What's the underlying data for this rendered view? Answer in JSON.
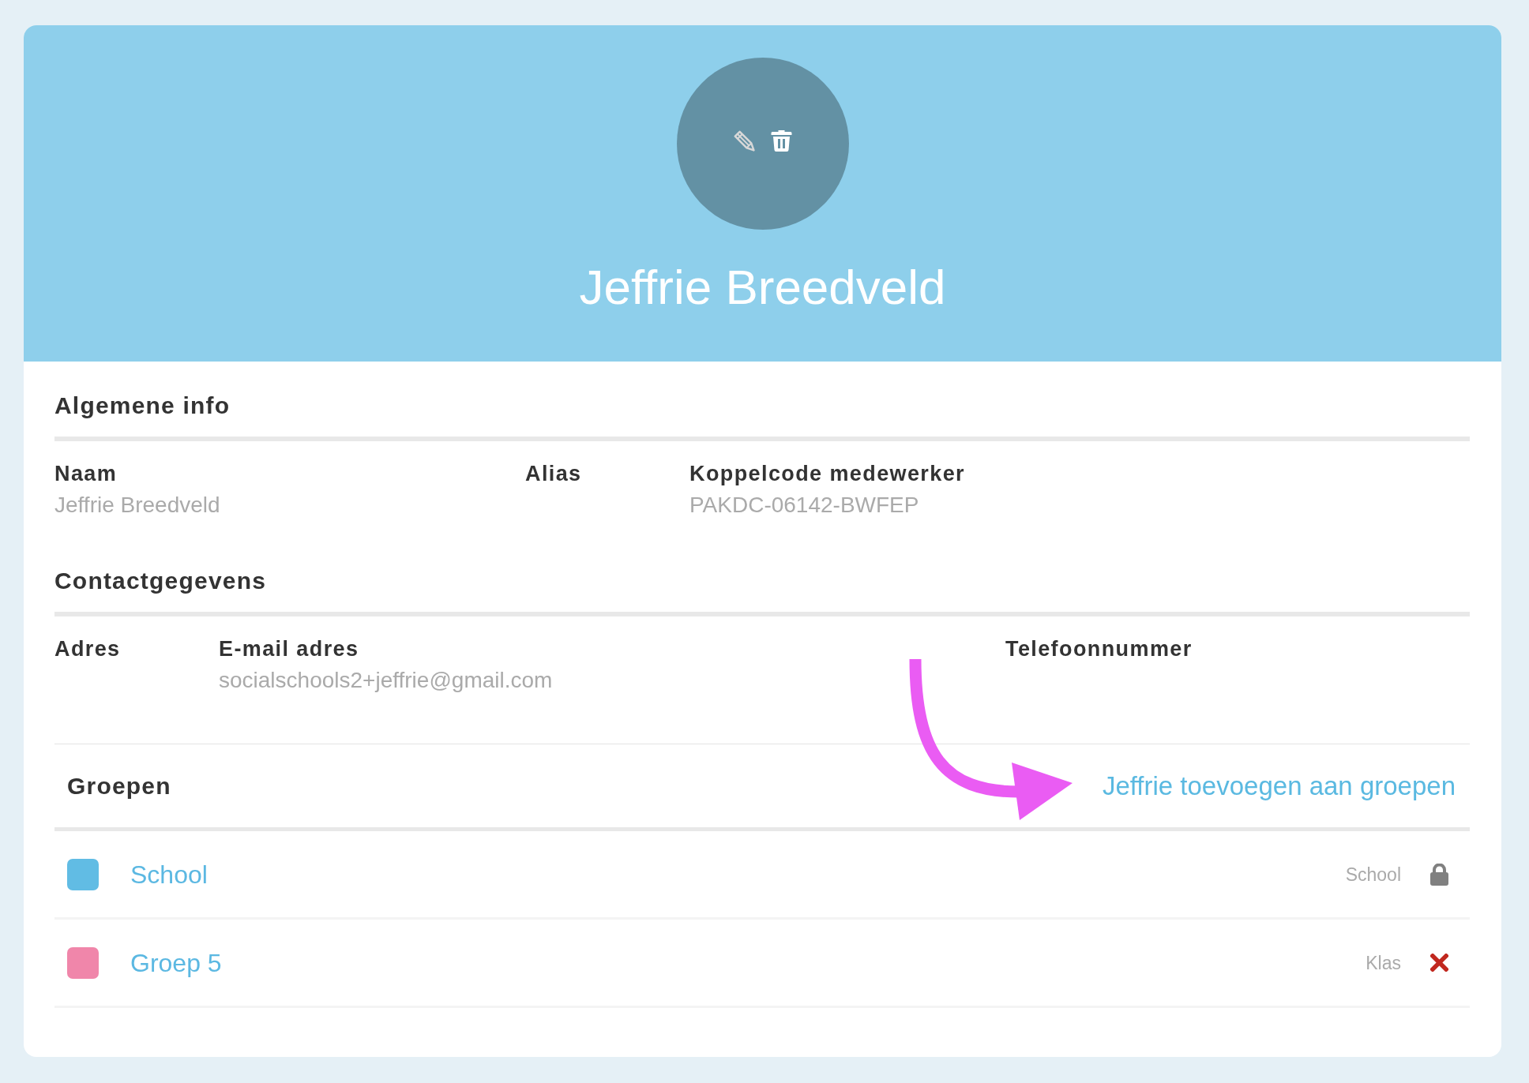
{
  "profile": {
    "name": "Jeffrie Breedveld"
  },
  "sections": [
    {
      "title": "Algemene info",
      "fields": [
        {
          "label": "Naam",
          "value": "Jeffrie Breedveld"
        },
        {
          "label": "Alias"
        },
        {
          "label": "Koppelcode medewerker",
          "value": "PAKDC-06142-BWFEP"
        }
      ]
    },
    {
      "title": "Contactgegevens",
      "fields": [
        {
          "label": "Adres"
        },
        {
          "label": "E-mail adres",
          "value": "socialschools2+jeffrie@gmail.com"
        },
        {
          "label": "Telefoonnummer"
        }
      ]
    }
  ],
  "groups": {
    "title": "Groepen",
    "add_link": "Jeffrie toevoegen aan groepen",
    "items": [
      {
        "name": "School",
        "color": "#61bce4",
        "type": "School",
        "locked": true
      },
      {
        "name": "Groep 5",
        "color": "#f086aa",
        "type": "Klas",
        "locked": false
      }
    ]
  }
}
